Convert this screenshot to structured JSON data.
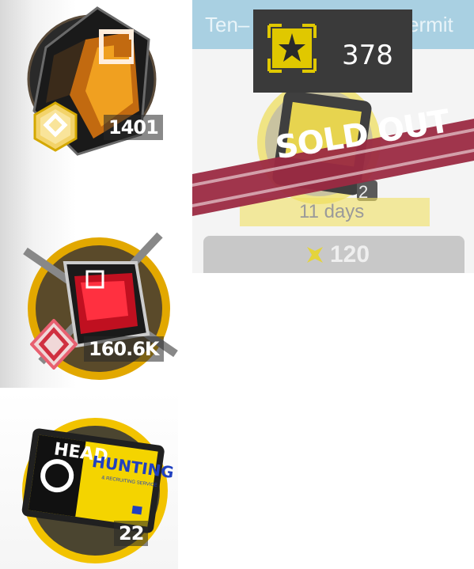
{
  "inventory": {
    "items": [
      {
        "name": "originium-prime",
        "count": "1401"
      },
      {
        "name": "red-cube-material",
        "count": "160.6K"
      },
      {
        "name": "headhunting-permit",
        "count": "22"
      }
    ],
    "permit_card_text": {
      "head": "HEAD",
      "hunting": "HUNTING",
      "sub": "& RECRUITING SERVICE"
    }
  },
  "shop_card": {
    "title": "Ten–",
    "title_suffix": "ermit",
    "status": "SOLD OUT",
    "duration": "11 days",
    "price": "120",
    "ticket_badge_number": "2"
  },
  "currency_badge": {
    "value": "378"
  },
  "colors": {
    "gold": "#f0c000",
    "sold_out_banner": "#9b2a42",
    "card_header": "#a9d0e2"
  }
}
